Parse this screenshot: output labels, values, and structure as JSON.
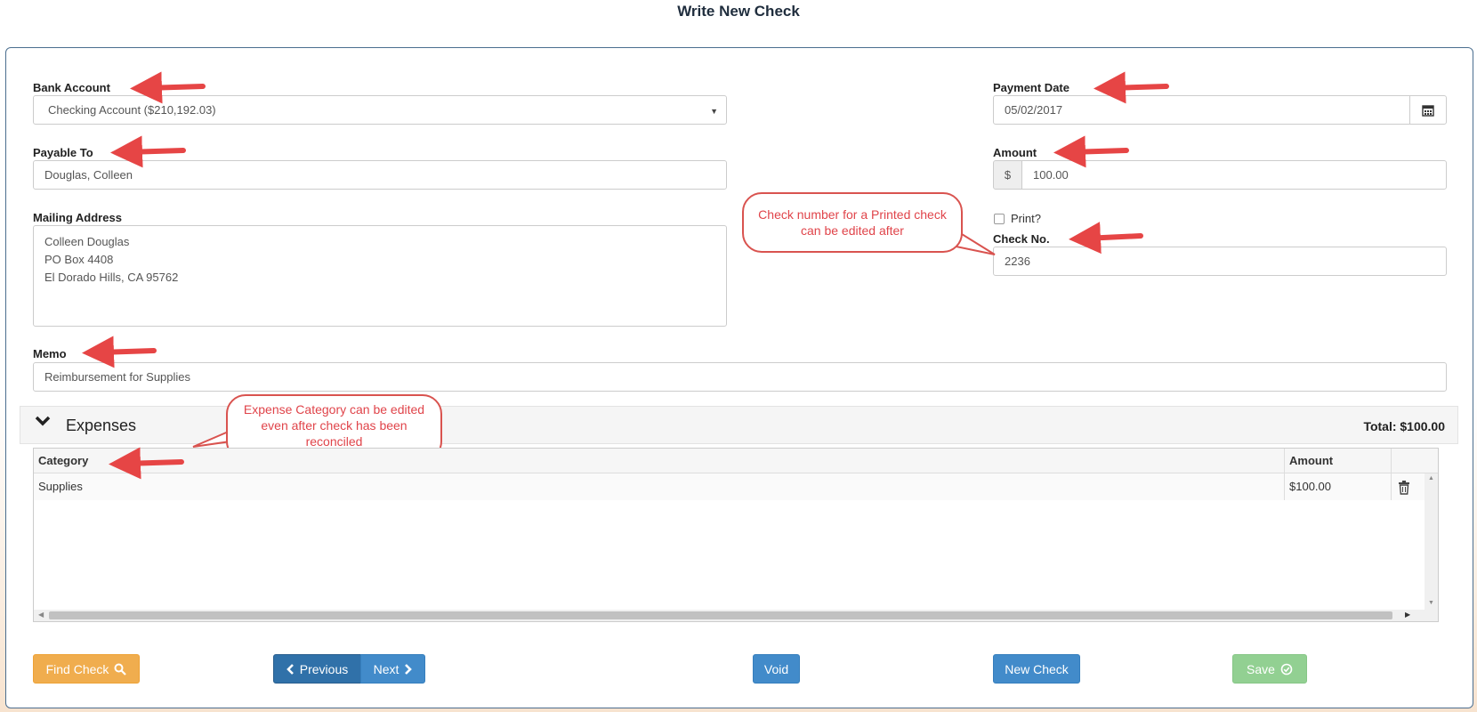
{
  "page": {
    "title": "Write New Check"
  },
  "form": {
    "bank_account": {
      "label": "Bank Account",
      "value": "Checking Account ($210,192.03)"
    },
    "payable_to": {
      "label": "Payable To",
      "value": "Douglas, Colleen"
    },
    "mailing_address": {
      "label": "Mailing Address",
      "lines": [
        "Colleen Douglas",
        "PO Box 4408",
        "El Dorado Hills, CA 95762"
      ]
    },
    "memo": {
      "label": "Memo",
      "value": "Reimbursement for Supplies"
    },
    "payment_date": {
      "label": "Payment Date",
      "value": "05/02/2017",
      "icon": "calendar-icon"
    },
    "amount": {
      "label": "Amount",
      "prefix": "$",
      "value": "100.00"
    },
    "print": {
      "label": "Print?",
      "checked": false
    },
    "check_no": {
      "label": "Check No.",
      "value": "2236"
    }
  },
  "callouts": {
    "check_number": "Check number for a Printed check can be edited after",
    "expense_category": "Expense Category can be edited even after check has been reconciled"
  },
  "expenses": {
    "title": "Expenses",
    "total": "Total: $100.00",
    "columns": [
      "Category",
      "Amount"
    ],
    "rows": [
      {
        "category": "Supplies",
        "amount": "$100.00"
      }
    ]
  },
  "buttons": {
    "find_check": "Find Check",
    "previous": "Previous",
    "next": "Next",
    "void": "Void",
    "new_check": "New Check",
    "save": "Save"
  },
  "colors": {
    "arrow": "#e64545",
    "primary": "#428bca",
    "warning": "#f0ad4e",
    "success_disabled": "#92d092"
  }
}
